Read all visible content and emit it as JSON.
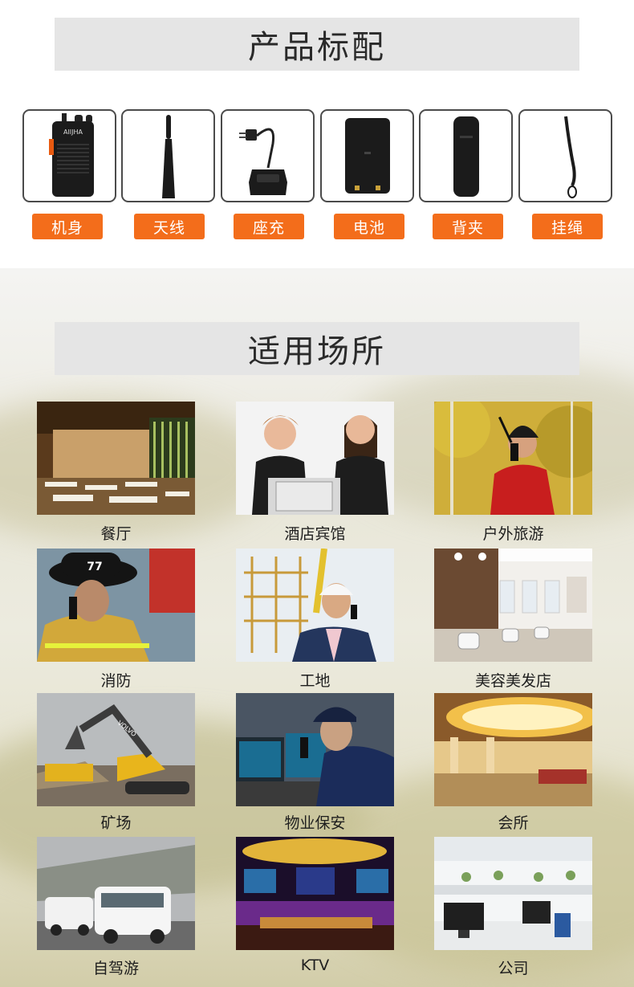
{
  "sections": {
    "config_title": "产品标配",
    "places_title": "适用场所"
  },
  "accessories": [
    {
      "label": "机身",
      "icon": "walkie-talkie-body-icon",
      "brand_text": "AIIJHA"
    },
    {
      "label": "天线",
      "icon": "antenna-icon"
    },
    {
      "label": "座充",
      "icon": "desktop-charger-icon"
    },
    {
      "label": "电池",
      "icon": "battery-icon"
    },
    {
      "label": "背夹",
      "icon": "belt-clip-icon"
    },
    {
      "label": "挂绳",
      "icon": "lanyard-icon"
    }
  ],
  "places": [
    {
      "label": "餐厅",
      "image": "restaurant-photo"
    },
    {
      "label": "酒店宾馆",
      "image": "hotel-reception-photo"
    },
    {
      "label": "户外旅游",
      "image": "outdoor-travel-photo"
    },
    {
      "label": "消防",
      "image": "firefighter-photo",
      "badge_text": "77"
    },
    {
      "label": "工地",
      "image": "construction-site-photo"
    },
    {
      "label": "美容美发店",
      "image": "beauty-salon-photo"
    },
    {
      "label": "矿场",
      "image": "mining-excavator-photo",
      "brand_text": "VOLVO"
    },
    {
      "label": "物业保安",
      "image": "security-guard-photo"
    },
    {
      "label": "会所",
      "image": "club-lobby-photo"
    },
    {
      "label": "自驾游",
      "image": "road-trip-photo"
    },
    {
      "label": "KTV",
      "image": "ktv-room-photo"
    },
    {
      "label": "公司",
      "image": "office-photo"
    }
  ],
  "colors": {
    "accent": "#f36d1b",
    "title_bar": "#e5e5e5",
    "card_border": "#4b4b4b"
  }
}
